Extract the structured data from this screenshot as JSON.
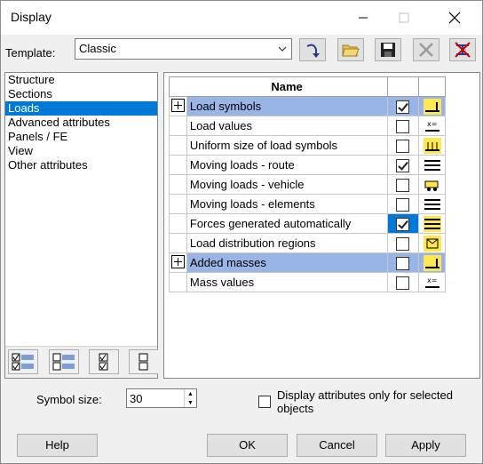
{
  "window": {
    "title": "Display"
  },
  "template": {
    "label": "Template:",
    "value": "Classic"
  },
  "sidebar": {
    "items": [
      {
        "label": "Structure"
      },
      {
        "label": "Sections"
      },
      {
        "label": "Loads"
      },
      {
        "label": "Advanced attributes"
      },
      {
        "label": "Panels / FE"
      },
      {
        "label": "View"
      },
      {
        "label": "Other attributes"
      }
    ],
    "selected_index": 2
  },
  "grid": {
    "header": "Name",
    "rows": [
      {
        "name": "Load symbols",
        "checked": true,
        "expand": true,
        "highlight": true,
        "icon": "load-symbol-icon"
      },
      {
        "name": "Load values",
        "checked": false,
        "icon": "load-value-icon"
      },
      {
        "name": "Uniform size of load symbols",
        "checked": false,
        "icon": "uniform-size-icon"
      },
      {
        "name": "Moving loads - route",
        "checked": true,
        "icon": "route-lines-icon"
      },
      {
        "name": "Moving loads - vehicle",
        "checked": false,
        "icon": "vehicle-icon"
      },
      {
        "name": "Moving loads - elements",
        "checked": false,
        "icon": "elements-lines-icon"
      },
      {
        "name": "Forces generated automatically",
        "checked": true,
        "icon": "auto-forces-icon",
        "focus": true
      },
      {
        "name": "Load distribution regions",
        "checked": false,
        "icon": "distribution-region-icon"
      },
      {
        "name": "Added masses",
        "checked": false,
        "expand": true,
        "highlight": true,
        "icon": "added-mass-icon"
      },
      {
        "name": "Mass values",
        "checked": false,
        "icon": "mass-value-icon"
      }
    ]
  },
  "symbol_size": {
    "label": "Symbol size:",
    "value": "30"
  },
  "selected_only": {
    "label": "Display attributes only for selected objects",
    "checked": false
  },
  "buttons": {
    "help": "Help",
    "ok": "OK",
    "cancel": "Cancel",
    "apply": "Apply"
  },
  "colors": {
    "selection": "#0078d7",
    "row_highlight": "#99b4e6",
    "dialog_bg": "#f0f0f0"
  }
}
